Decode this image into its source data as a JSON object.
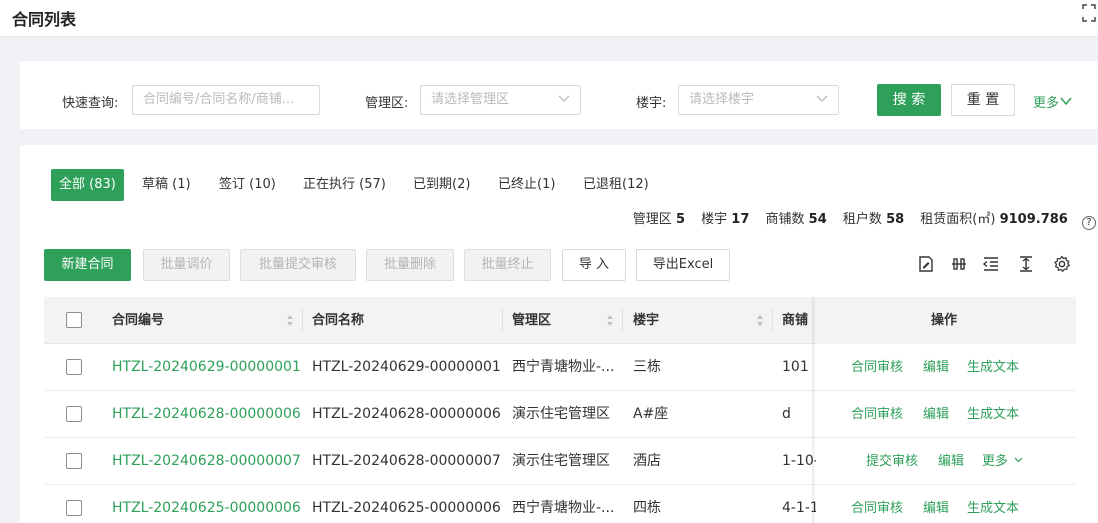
{
  "page": {
    "title": "合同列表"
  },
  "search": {
    "quick_label": "快速查询:",
    "quick_placeholder": "合同编号/合同名称/商铺...",
    "area_label": "管理区:",
    "area_placeholder": "请选择管理区",
    "building_label": "楼宇:",
    "building_placeholder": "请选择楼宇",
    "search_btn": "搜 索",
    "reset_btn": "重 置",
    "more": "更多"
  },
  "tabs": [
    {
      "label": "全部 (83)",
      "active": true
    },
    {
      "label": "草稿 (1)"
    },
    {
      "label": "签订 (10)"
    },
    {
      "label": "正在执行 (57)"
    },
    {
      "label": "已到期(2)"
    },
    {
      "label": "已终止(1)"
    },
    {
      "label": "已退租(12)"
    }
  ],
  "stats": {
    "area_label": "管理区",
    "area_value": "5",
    "building_label": "楼宇",
    "building_value": "17",
    "shop_label": "商铺数",
    "shop_value": "54",
    "tenant_label": "租户数",
    "tenant_value": "58",
    "rent_label": "租赁面积(㎡)",
    "rent_value": "9109.786",
    "help": "?"
  },
  "toolbar": {
    "new": "新建合同",
    "batch_price": "批量调价",
    "batch_submit": "批量提交审核",
    "batch_delete": "批量删除",
    "batch_stop": "批量终止",
    "import": "导 入",
    "export": "导出Excel"
  },
  "tool_icons": [
    "edit-icon",
    "column-settings-icon",
    "indent-icon",
    "row-height-icon",
    "gear-icon"
  ],
  "colors": {
    "primary": "#2ea05a",
    "page_bg": "#f0f2f5",
    "header_bg": "#f3f3f3"
  },
  "table": {
    "headers": {
      "code": "合同编号",
      "name": "合同名称",
      "area": "管理区",
      "building": "楼宇",
      "shop": "商铺",
      "ops": "操作"
    },
    "rows": [
      {
        "code": "HTZL-20240629-00000001",
        "name": "HTZL-20240629-00000001",
        "area": "西宁青塘物业-...",
        "building": "三栋",
        "shop": "101",
        "ops": [
          "合同审核",
          "编辑",
          "生成文本"
        ]
      },
      {
        "code": "HTZL-20240628-00000006",
        "name": "HTZL-20240628-00000006",
        "area": "演示住宅管理区",
        "building": "A#座",
        "shop": "d",
        "ops": [
          "合同审核",
          "编辑",
          "生成文本"
        ]
      },
      {
        "code": "HTZL-20240628-00000007",
        "name": "HTZL-20240628-00000007",
        "area": "演示住宅管理区",
        "building": "酒店",
        "shop": "1-10-",
        "ops": [
          "提交审核",
          "编辑",
          "更多"
        ]
      },
      {
        "code": "HTZL-20240625-00000006",
        "name": "HTZL-20240625-00000006",
        "area": "西宁青塘物业-...",
        "building": "四栋",
        "shop": "4-1-1",
        "ops": [
          "合同审核",
          "编辑",
          "生成文本"
        ]
      }
    ]
  }
}
